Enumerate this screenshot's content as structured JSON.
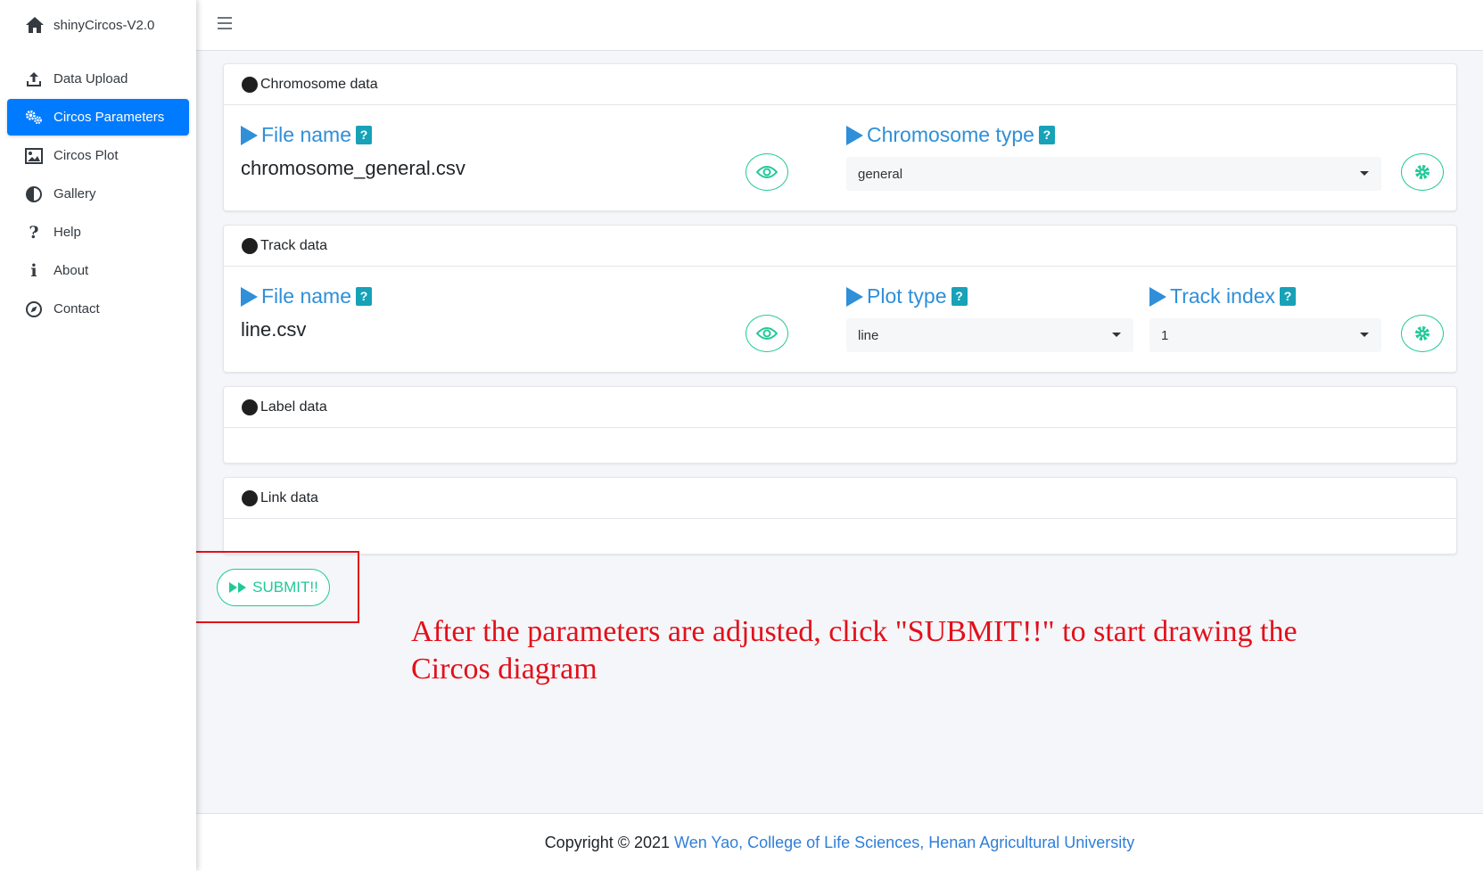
{
  "app": {
    "brand": "shinyCircos-V2.0"
  },
  "sidebar": {
    "items": [
      {
        "label": "Data Upload",
        "icon": "upload-icon"
      },
      {
        "label": "Circos Parameters",
        "icon": "gears-icon"
      },
      {
        "label": "Circos Plot",
        "icon": "image-icon"
      },
      {
        "label": "Gallery",
        "icon": "adjust-icon"
      },
      {
        "label": "Help",
        "icon": "question-icon"
      },
      {
        "label": "About",
        "icon": "info-icon"
      },
      {
        "label": "Contact",
        "icon": "compass-icon"
      }
    ],
    "active_index": 1
  },
  "panels": {
    "chromosome": {
      "title": "Chromosome data",
      "file_label": "File name",
      "file_value": "chromosome_general.csv",
      "type_label": "Chromosome type",
      "type_value": "general",
      "help": "?"
    },
    "track": {
      "title": "Track data",
      "file_label": "File name",
      "file_value": "line.csv",
      "plot_type_label": "Plot type",
      "plot_type_value": "line",
      "track_index_label": "Track index",
      "track_index_value": "1",
      "help": "?"
    },
    "label": {
      "title": "Label data"
    },
    "link": {
      "title": "Link data"
    }
  },
  "submit": {
    "label": "SUBMIT!!"
  },
  "annotation": {
    "text": "After the parameters are adjusted, click \"SUBMIT!!\" to start drawing the Circos diagram",
    "color": "#e3101a"
  },
  "footer": {
    "copyright": "Copyright © 2021",
    "link": "Wen Yao, College of Life Sciences, Henan Agricultural University"
  },
  "colors": {
    "primary": "#007bff",
    "label_blue": "#2f8fd8",
    "teal": "#20c997",
    "help_badge": "#17a2b8"
  }
}
